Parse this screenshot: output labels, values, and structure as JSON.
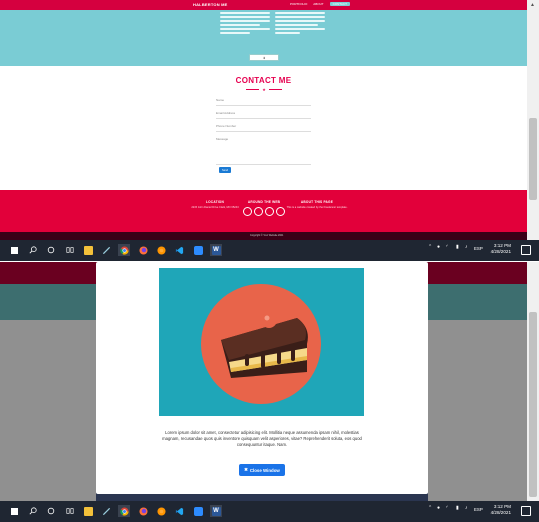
{
  "top": {
    "nav": {
      "brand": "HALBERTON ME",
      "links": [
        "PORTFOLIO",
        "ABOUT",
        "CONTACT"
      ]
    },
    "contact": {
      "title": "CONTACT ME",
      "fields": [
        "Name",
        "Email Address",
        "Phone Number",
        "Message"
      ],
      "send_label": "Send"
    },
    "footer": {
      "columns": [
        {
          "heading": "LOCATION",
          "text": "2215 John Daniel Drive Clark, MO 65243"
        },
        {
          "heading": "AROUND THE WEB",
          "text": ""
        },
        {
          "heading": "ABOUT THIS PAGE",
          "text": "This is a website created by the Freelancer template."
        }
      ],
      "copyright": "Copyright © Your Website 2021"
    }
  },
  "taskbar_top": {
    "clock_time": "3:12 PM",
    "clock_date": "4/28/2021",
    "lang": "ESP"
  },
  "bottom": {
    "modal": {
      "lorem": "Lorem ipsum dolor sit amet, consectetur adipisicing elit. Mollitia neque assumenda ipsam nihil, molestias magnam, recusandae quos quis inventore quisquam velit asperiores, vitae? Reprehenderit soluta, eos quod consequuntur itaque. Nam.",
      "close_label": "Close Window"
    }
  },
  "taskbar_bottom": {
    "clock_time": "3:12 PM",
    "clock_date": "4/28/2021",
    "lang": "ESP"
  },
  "colors": {
    "brand_red": "#e2003a",
    "teal": "#7accd4",
    "modal_teal": "#1fa6b8",
    "accent_blue": "#1a73e8"
  }
}
